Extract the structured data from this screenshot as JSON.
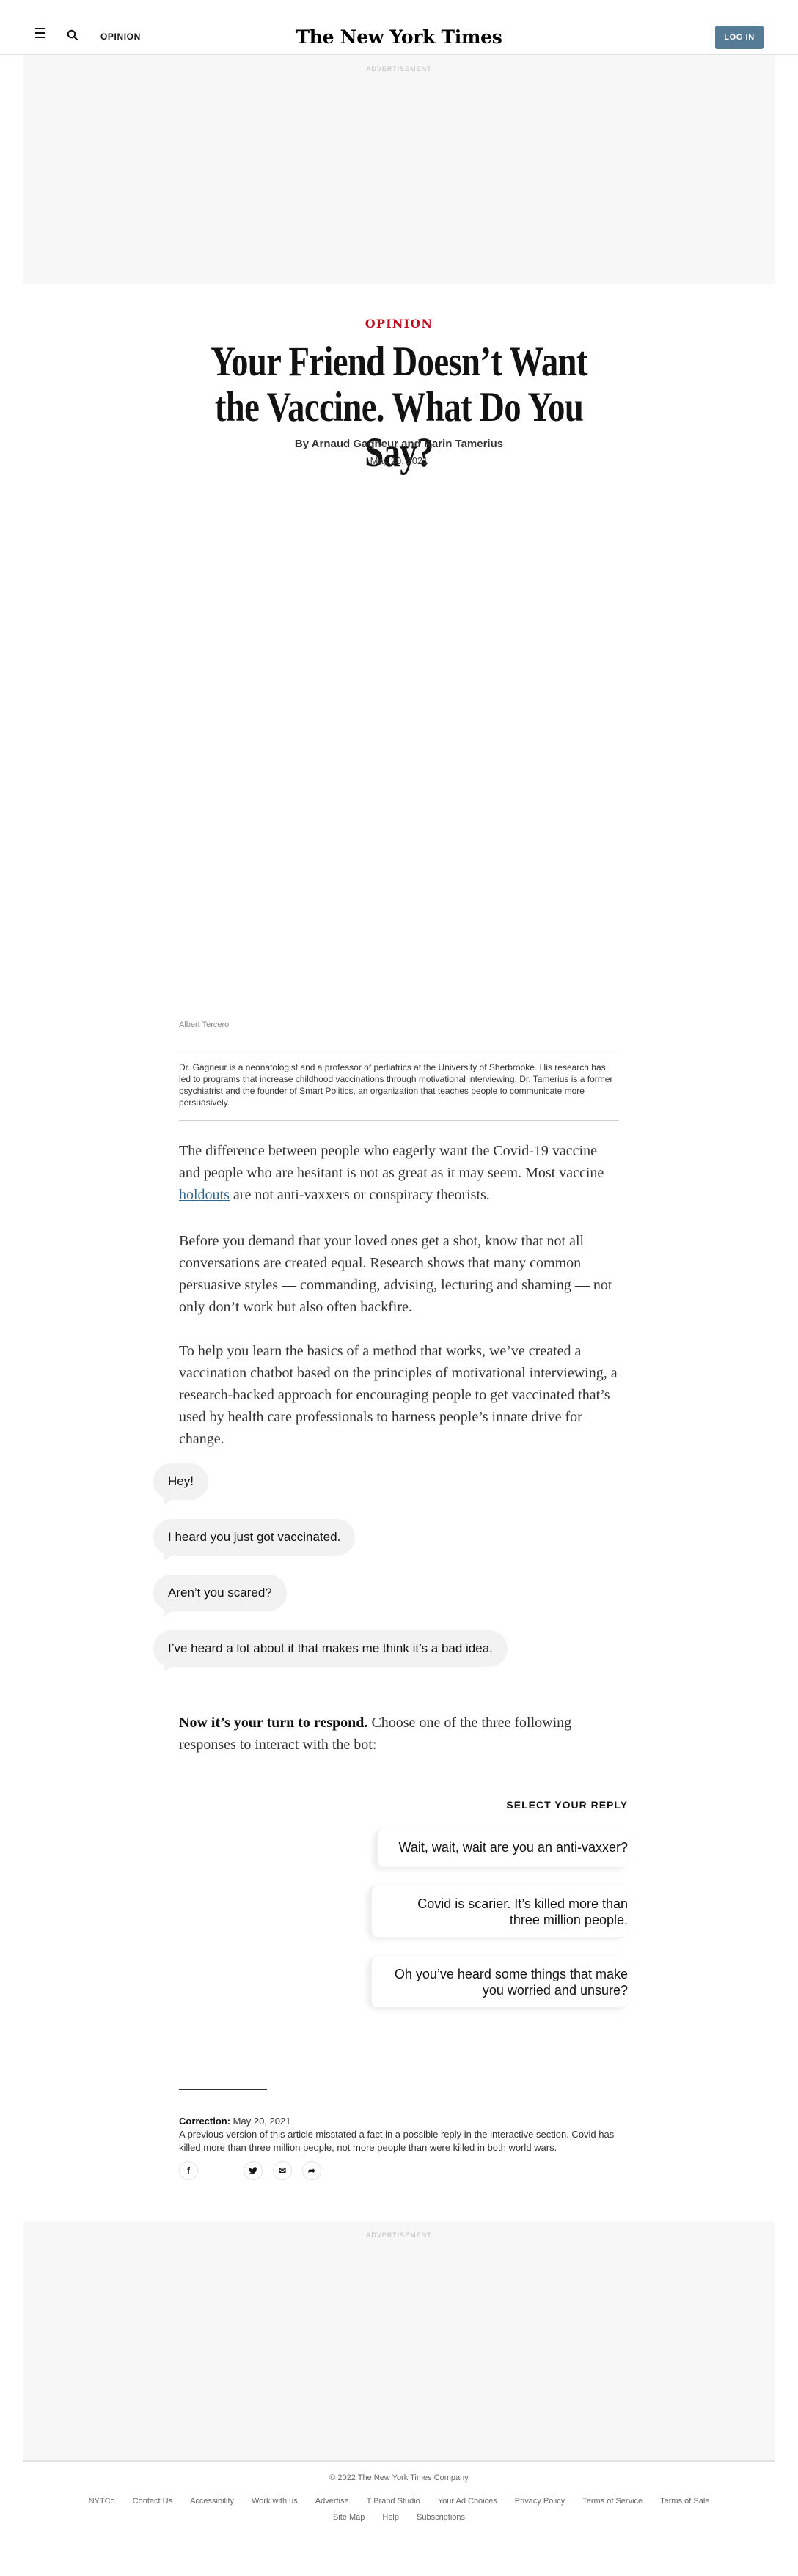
{
  "header": {
    "section": "OPINION",
    "logo": "The New York Times",
    "login": "LOG IN"
  },
  "ads": {
    "label": "ADVERTISEMENT"
  },
  "article": {
    "kicker": "OPINION",
    "headline": "Your Friend Doesn’t Want the Vaccine. What Do You Say?",
    "byline": "By Arnaud Gagneur and Karin Tamerius",
    "date": "May 20, 2021",
    "image_credit": "Albert Tercero",
    "bio": "Dr. Gagneur is a neonatologist and a professor of pediatrics at the University of Sherbrooke. His research has led to programs that increase childhood vaccinations through motivational interviewing. Dr. Tamerius is a former psychiatrist and the founder of Smart Politics, an organization that teaches people to communicate more persuasively.",
    "p1_before": "The difference between people who eagerly want the Covid-19 vaccine and people who are hesitant is not as great as it may seem. Most vaccine ",
    "p1_link": "holdouts",
    "p1_after": " are not anti-vaxxers or conspiracy theorists.",
    "p2": "Before you demand that your loved ones get a shot, know that not all conversations are created equal. Research shows that many common persuasive styles — commanding, advising, lecturing and shaming — not only don’t work but also often backfire.",
    "p3": "To help you learn the basics of a method that works, we’ve created a vaccination chatbot based on the principles of motivational interviewing, a research-backed approach for encouraging people to get vaccinated that’s used by health care professionals to harness people’s innate drive for change."
  },
  "chat": {
    "messages": [
      "Hey!",
      "I heard you just got vaccinated.",
      "Aren’t you scared?",
      "I’ve heard a lot about it that makes me think it’s a bad idea."
    ],
    "prompt_bold": "Now it’s your turn to respond.",
    "prompt_rest": " Choose one of the three following responses to interact with the bot:",
    "select_label": "SELECT YOUR REPLY",
    "replies": [
      "Wait, wait, wait are you an anti-vaxxer?",
      "Covid is scarier. It’s killed more than three million people.",
      "Oh you’ve heard some things that make you worried and unsure?"
    ]
  },
  "correction": {
    "label": "Correction:",
    "date": " May 20, 2021",
    "text": "A previous version of this article misstated a fact in a possible reply in the interactive section. Covid has killed more than three million people, not more people than were killed in both world wars."
  },
  "share": {
    "facebook": "f",
    "twitter": "t",
    "email": "✉",
    "more": "➦"
  },
  "footer": {
    "copyright": "© 2022 The New York Times Company",
    "links": [
      "NYTCo",
      "Contact Us",
      "Accessibility",
      "Work with us",
      "Advertise",
      "T Brand Studio",
      "Your Ad Choices",
      "Privacy Policy",
      "Terms of Service",
      "Terms of Sale",
      "Site Map",
      "Help",
      "Subscriptions"
    ]
  },
  "colors": {
    "kicker": "#c10d20",
    "login_button": "#567b95",
    "link": "#326891"
  }
}
